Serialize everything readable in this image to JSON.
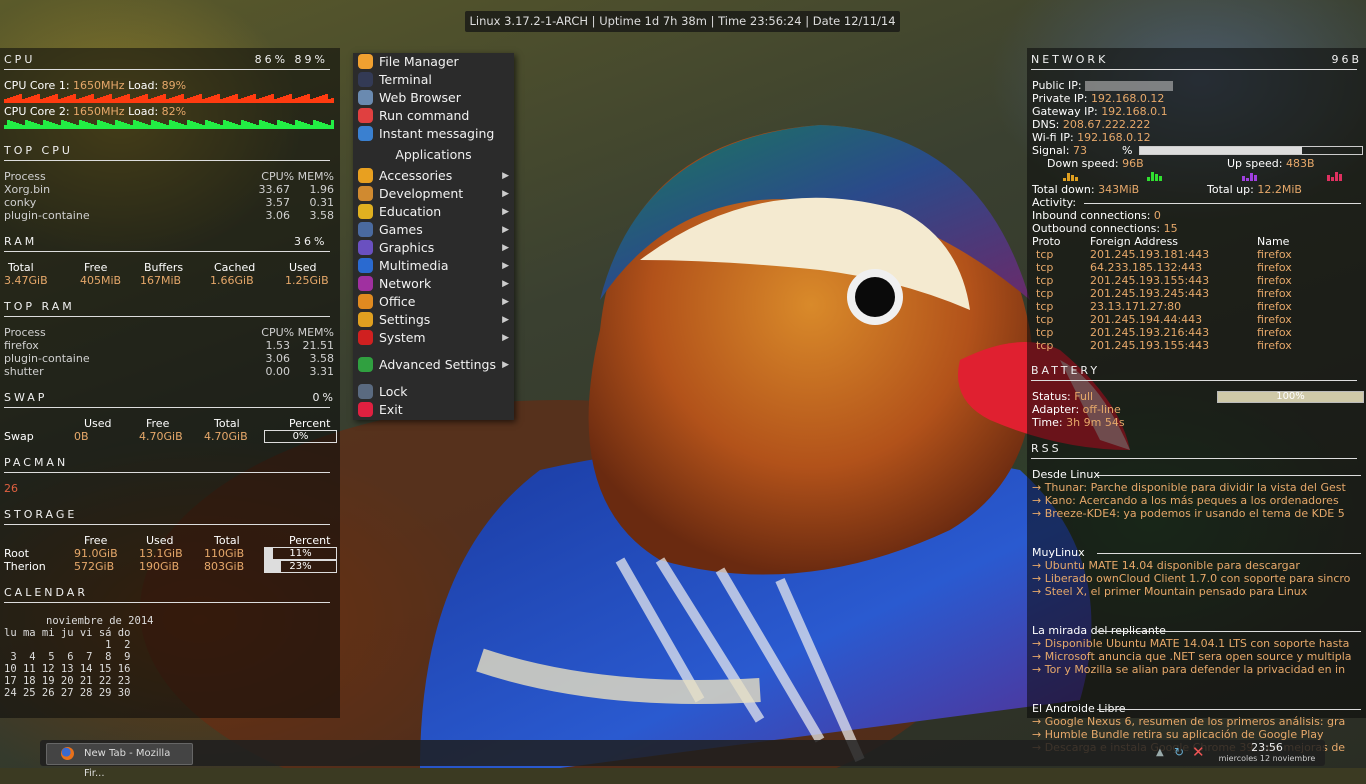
{
  "topbar": {
    "text": "Linux 3.17.2-1-ARCH | Uptime  1d 7h 38m | Time 23:56:24 | Date 12/11/14"
  },
  "cpu": {
    "title": "CPU",
    "percents": "86%  89%",
    "core1": {
      "label": "CPU Core 1:",
      "freq": "1650MHz",
      "load_label": "Load:",
      "load": "89%"
    },
    "core2": {
      "label": "CPU Core 2:",
      "freq": "1650MHz",
      "load_label": "Load:",
      "load": "82%"
    },
    "core1_color": "#ff3b10",
    "core2_color": "#22ee44"
  },
  "top_cpu": {
    "title": "TOP CPU",
    "headers": [
      "Process",
      "CPU% MEM%"
    ],
    "rows": [
      {
        "name": "Xorg.bin",
        "cpu": "33.67",
        "mem": "1.96"
      },
      {
        "name": "conky",
        "cpu": "3.57",
        "mem": "0.31"
      },
      {
        "name": "plugin-containe",
        "cpu": "3.06",
        "mem": "3.58"
      }
    ]
  },
  "ram": {
    "title": "RAM",
    "percent": "36%",
    "headers": [
      "Total",
      "Free",
      "Buffers",
      "Cached",
      "Used"
    ],
    "values": [
      "3.47GiB",
      "405MiB",
      "167MiB",
      "1.66GiB",
      "1.25GiB"
    ]
  },
  "top_ram": {
    "title": "TOP RAM",
    "headers": [
      "Process",
      "CPU% MEM%"
    ],
    "rows": [
      {
        "name": "firefox",
        "cpu": "1.53",
        "mem": "21.51"
      },
      {
        "name": "plugin-containe",
        "cpu": "3.06",
        "mem": "3.58"
      },
      {
        "name": "shutter",
        "cpu": "0.00",
        "mem": "3.31"
      }
    ]
  },
  "swap": {
    "title": "SWAP",
    "percent": "0%",
    "headers": [
      "Used",
      "Free",
      "Total",
      "Percent"
    ],
    "label": "Swap",
    "values": [
      "0B",
      "4.70GiB",
      "4.70GiB",
      "0%"
    ],
    "fill": 0.0
  },
  "pacman": {
    "title": "PACMAN",
    "value": "26"
  },
  "storage": {
    "title": "STORAGE",
    "headers": [
      "Free",
      "Used",
      "Total",
      "Percent"
    ],
    "rows": [
      {
        "name": "Root",
        "free": "91.0GiB",
        "used": "13.1GiB",
        "total": "110GiB",
        "percent": "11%",
        "fill": 0.11
      },
      {
        "name": "Therion",
        "free": "572GiB",
        "used": "190GiB",
        "total": "803GiB",
        "percent": "23%",
        "fill": 0.23
      }
    ]
  },
  "calendar": {
    "title": "CALENDAR",
    "month": "noviembre de 2014",
    "weekdays": "lu ma mi ju vi sá do",
    "weeks": [
      "                1  2",
      " 3  4  5  6  7  8  9",
      "10 11 12 13 14 15 16",
      "17 18 19 20 21 22 23",
      "24 25 26 27 28 29 30"
    ]
  },
  "menu": {
    "top_items": [
      {
        "label": "File Manager",
        "icon": "folder-icon",
        "color": "#f0a030"
      },
      {
        "label": "Terminal",
        "icon": "terminal-icon",
        "color": "#333a55"
      },
      {
        "label": "Web Browser",
        "icon": "globe-icon",
        "color": "#6a8ab0"
      },
      {
        "label": "Run command",
        "icon": "gear-run-icon",
        "color": "#e04040"
      },
      {
        "label": "Instant messaging",
        "icon": "user-chat-icon",
        "color": "#3a80d0"
      }
    ],
    "header": "Applications",
    "categories": [
      {
        "label": "Accessories",
        "icon": "accessories-icon",
        "color": "#e8a020"
      },
      {
        "label": "Development",
        "icon": "development-icon",
        "color": "#d08a30"
      },
      {
        "label": "Education",
        "icon": "education-icon",
        "color": "#e0b020"
      },
      {
        "label": "Games",
        "icon": "games-icon",
        "color": "#4a6aa0"
      },
      {
        "label": "Graphics",
        "icon": "graphics-icon",
        "color": "#6a50c0"
      },
      {
        "label": "Multimedia",
        "icon": "multimedia-icon",
        "color": "#2a6ad0"
      },
      {
        "label": "Network",
        "icon": "network-icon",
        "color": "#a030a0"
      },
      {
        "label": "Office",
        "icon": "office-icon",
        "color": "#e08a20"
      },
      {
        "label": "Settings",
        "icon": "settings-icon",
        "color": "#e0a020"
      },
      {
        "label": "System",
        "icon": "system-icon",
        "color": "#d02020"
      }
    ],
    "advanced": {
      "label": "Advanced Settings",
      "icon": "advanced-settings-icon",
      "color": "#30a040"
    },
    "lock": {
      "label": "Lock",
      "icon": "lock-icon",
      "color": "#5a6a80"
    },
    "exit": {
      "label": "Exit",
      "icon": "power-icon",
      "color": "#e02040"
    },
    "arrow": "▶"
  },
  "network": {
    "title": "NETWORK",
    "speed": "96B",
    "public_ip_label": "Public IP:",
    "private_ip_label": "Private IP:",
    "private_ip": "192.168.0.12",
    "gateway_label": "Gateway IP:",
    "gateway": "192.168.0.1",
    "dns_label": "DNS:",
    "dns": "208.67.222.222",
    "wifi_label": "Wi-fi IP:",
    "wifi": "192.168.0.12",
    "signal_label": "Signal:",
    "signal": "73",
    "signal_unit": "%",
    "signal_fill": 0.73,
    "down_label": "Down speed:",
    "down": "96B",
    "up_label": "Up speed:",
    "up": "483B",
    "total_down_label": "Total down:",
    "total_down": "343MiB",
    "total_up_label": "Total up:",
    "total_up": "12.2MiB",
    "activity_label": "Activity:",
    "inbound_label": "Inbound connections:",
    "inbound": "0",
    "outbound_label": "Outbound connections:",
    "outbound": "15",
    "conn_headers": [
      "Proto",
      "Foreign Address",
      "Name"
    ],
    "connections": [
      {
        "proto": "tcp",
        "addr": "201.245.193.181:443",
        "name": "firefox"
      },
      {
        "proto": "tcp",
        "addr": "64.233.185.132:443",
        "name": "firefox"
      },
      {
        "proto": "tcp",
        "addr": "201.245.193.155:443",
        "name": "firefox"
      },
      {
        "proto": "tcp",
        "addr": "201.245.193.245:443",
        "name": "firefox"
      },
      {
        "proto": "tcp",
        "addr": "23.13.171.27:80",
        "name": "firefox"
      },
      {
        "proto": "tcp",
        "addr": "201.245.194.44:443",
        "name": "firefox"
      },
      {
        "proto": "tcp",
        "addr": "201.245.193.216:443",
        "name": "firefox"
      },
      {
        "proto": "tcp",
        "addr": "201.245.193.155:443",
        "name": "firefox"
      }
    ]
  },
  "battery": {
    "title": "BATTERY",
    "status_label": "Status:",
    "status": "Full",
    "percent": "100%",
    "fill": 1.0,
    "adapter_label": "Adapter:",
    "adapter": "off-line",
    "time_label": "Time:",
    "time": "3h 9m 54s"
  },
  "rss": {
    "title": "RSS",
    "feeds": [
      {
        "name": "Desde Linux",
        "items": [
          "→ Thunar: Parche disponible para dividir la vista del Gest",
          "→ Kano: Acercando a los más peques a los ordenadores",
          "→ Breeze-KDE4: ya podemos ir usando el tema de KDE 5"
        ]
      },
      {
        "name": "MuyLinux",
        "items": [
          "→ Ubuntu MATE 14.04 disponible para descargar",
          "→ Liberado ownCloud Client 1.7.0 con soporte para sincro",
          "→ Steel X, el primer Mountain pensado para Linux"
        ]
      },
      {
        "name": "La mirada del replicante",
        "items": [
          "→ Disponible Ubuntu MATE 14.04.1 LTS con soporte hasta",
          "→ Microsoft anuncia que .NET sera open source y multipla",
          "→ Tor y Mozilla se alian para defender la privacidad en in"
        ]
      },
      {
        "name": "El Androide Libre",
        "items": [
          "→ Google Nexus 6, resumen de los primeros análisis: gra",
          "→ Humble Bundle retira su aplicación de Google Play",
          "→ Descarga e instala Google Chrome 39, con mejoras de"
        ]
      }
    ]
  },
  "taskbar": {
    "task_label": "New Tab - Mozilla Fir...",
    "task_icon": "firefox-icon",
    "clock_time": "23:56",
    "clock_date": "miercoles 12 noviembre",
    "tray_icons": [
      "network-tray-icon",
      "sync-tray-icon",
      "close-x-tray-icon"
    ]
  }
}
